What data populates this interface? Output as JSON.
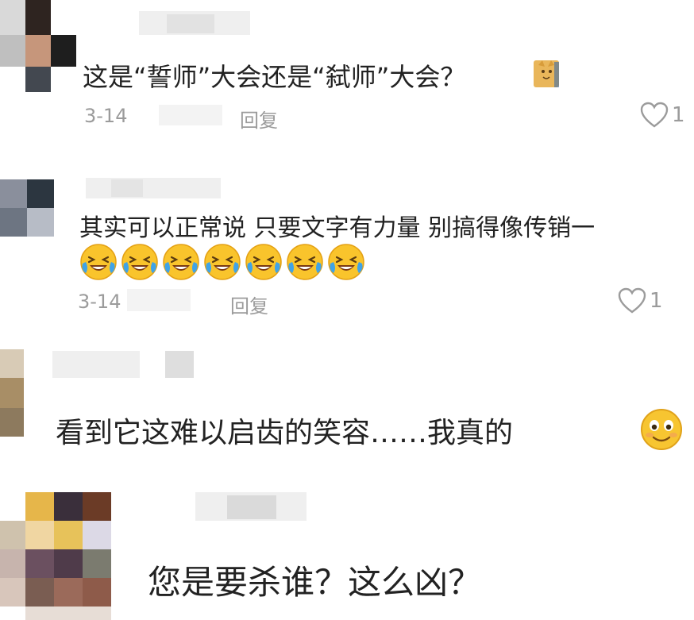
{
  "comments": [
    {
      "text": "这是“誓师”大会还是“弑师”大会？",
      "date": "3-14",
      "reply_label": "回复",
      "like_count": "1",
      "emoji": "cat-sticker-icon",
      "avatar_colors": [
        "#3d2f2b",
        "#c89a7c",
        "#2a2a2a",
        "#4a4f55",
        "#a9a9a9",
        "#1b1b1b"
      ]
    },
    {
      "text": "其实可以正常说 只要文字有力量 别搞得像传销一",
      "date": "3-14",
      "reply_label": "回复",
      "like_count": "1",
      "emoji": "laughing-crying-icon",
      "emoji_count": 7,
      "avatar_colors": [
        "#8a8f9c",
        "#2c3640",
        "#6d7582",
        "#b7bcc6"
      ]
    },
    {
      "text": "看到它这难以启齿的笑容……我真的",
      "emoji": "smiling-face-icon",
      "avatar_colors": [
        "#c9b8a0",
        "#a88e66",
        "#8d7a5e"
      ]
    },
    {
      "text": "您是要杀谁？这么凶？",
      "avatar_colors": [
        "#e6b64a",
        "#3a2f3b",
        "#6b3b26",
        "#d4c29a",
        "#e0c17f",
        "#e7c25a",
        "#c9c5d4",
        "#a58a82",
        "#4f3b4a",
        "#6b6b6b",
        "#9c8a7a",
        "#7a5d52",
        "#9b6a5a",
        "#c9b6a6"
      ]
    }
  ]
}
